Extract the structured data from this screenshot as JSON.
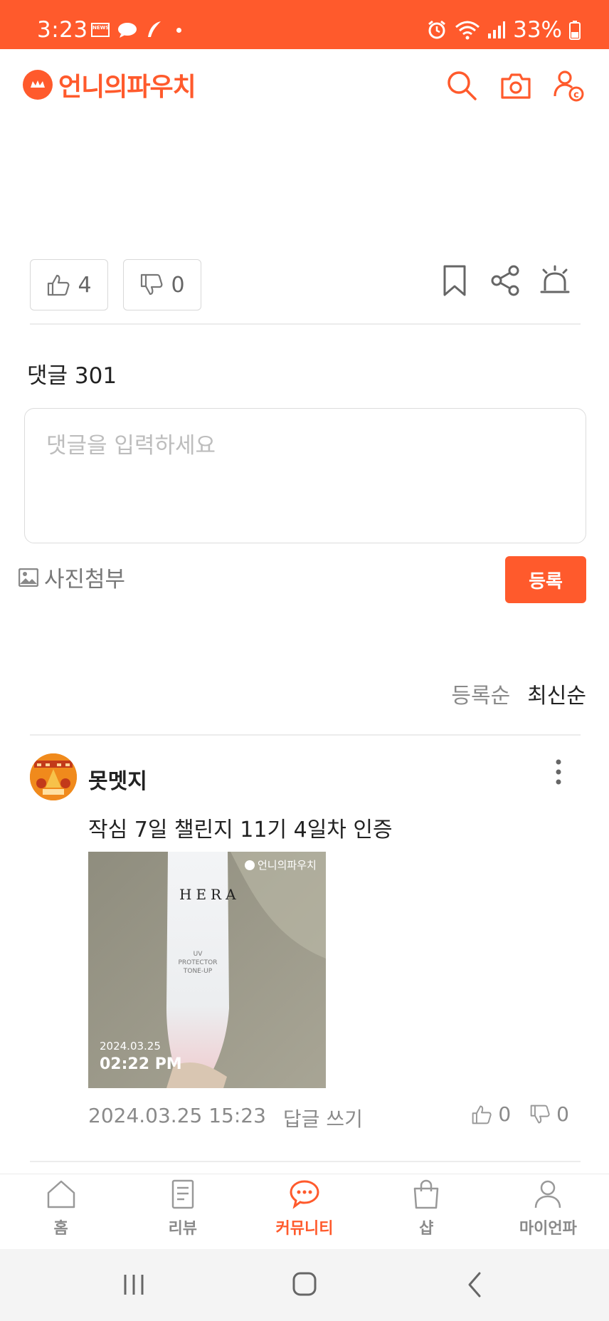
{
  "status_bar": {
    "time": "3:23",
    "news_badge": "NEWS",
    "battery": "33%"
  },
  "app": {
    "brand": "언니의파우치",
    "accent": "#ff5a2c"
  },
  "post_actions": {
    "like_count": "4",
    "dislike_count": "0"
  },
  "comments": {
    "title": "댓글 301",
    "input_placeholder": "댓글을 입력하세요",
    "attach_label": "사진첨부",
    "submit_label": "등록",
    "sort_options": [
      "등록순",
      "최신순"
    ],
    "sort_selected": "최신순",
    "items": [
      {
        "author": "못멧지",
        "text": "작심 7일 챌린지 11기 4일차 인증",
        "photo": {
          "watermark": "언니의파우치",
          "brand_text": "HERA",
          "product_lines": [
            "UV",
            "PROTECTOR",
            "TONE-UP"
          ],
          "date": "2024.03.25",
          "time": "02:22 PM"
        },
        "datetime": "2024.03.25 15:23",
        "reply_label": "답글 쓰기",
        "likes": "0",
        "dislikes": "0"
      }
    ]
  },
  "tabs": [
    {
      "label": "홈",
      "icon": "home-icon"
    },
    {
      "label": "리뷰",
      "icon": "review-icon"
    },
    {
      "label": "커뮤니티",
      "icon": "chat-bubble-icon",
      "active": true
    },
    {
      "label": "샵",
      "icon": "shopping-bag-icon"
    },
    {
      "label": "마이언파",
      "icon": "person-icon"
    }
  ]
}
